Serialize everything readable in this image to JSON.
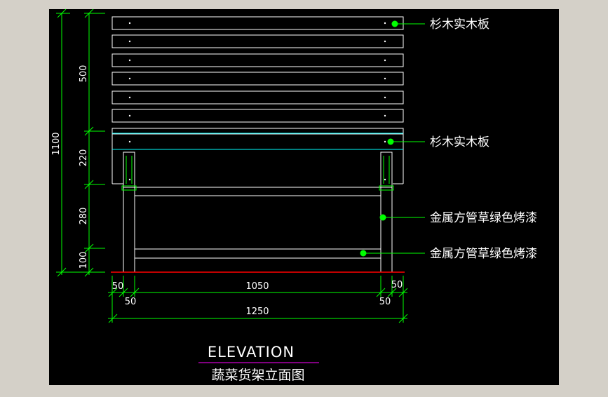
{
  "colors": {
    "frame": "#d4d0c8",
    "canvas": "#000000",
    "line": "#ffffff",
    "dimension": "#00ff00",
    "cyan": "#00ffff",
    "ground": "#ff0000",
    "title_underline": "#ff00ff"
  },
  "callouts": {
    "top_board": "杉木实木板",
    "apron_board": "杉木实木板",
    "leg_tube": "金属方管草绿色烤漆",
    "rail_tube": "金属方管草绿色烤漆"
  },
  "dimensions": {
    "overall_height": "1100",
    "back_height": "500",
    "apron_height": "220",
    "leg_upper": "280",
    "leg_lower": "100",
    "leg_width_left": "50",
    "inner_span": "1050",
    "leg_width_right": "50",
    "left_inset": "50",
    "right_inset": "50",
    "overall_width": "1250"
  },
  "title": {
    "english": "ELEVATION",
    "chinese": "蔬菜货架立面图"
  }
}
